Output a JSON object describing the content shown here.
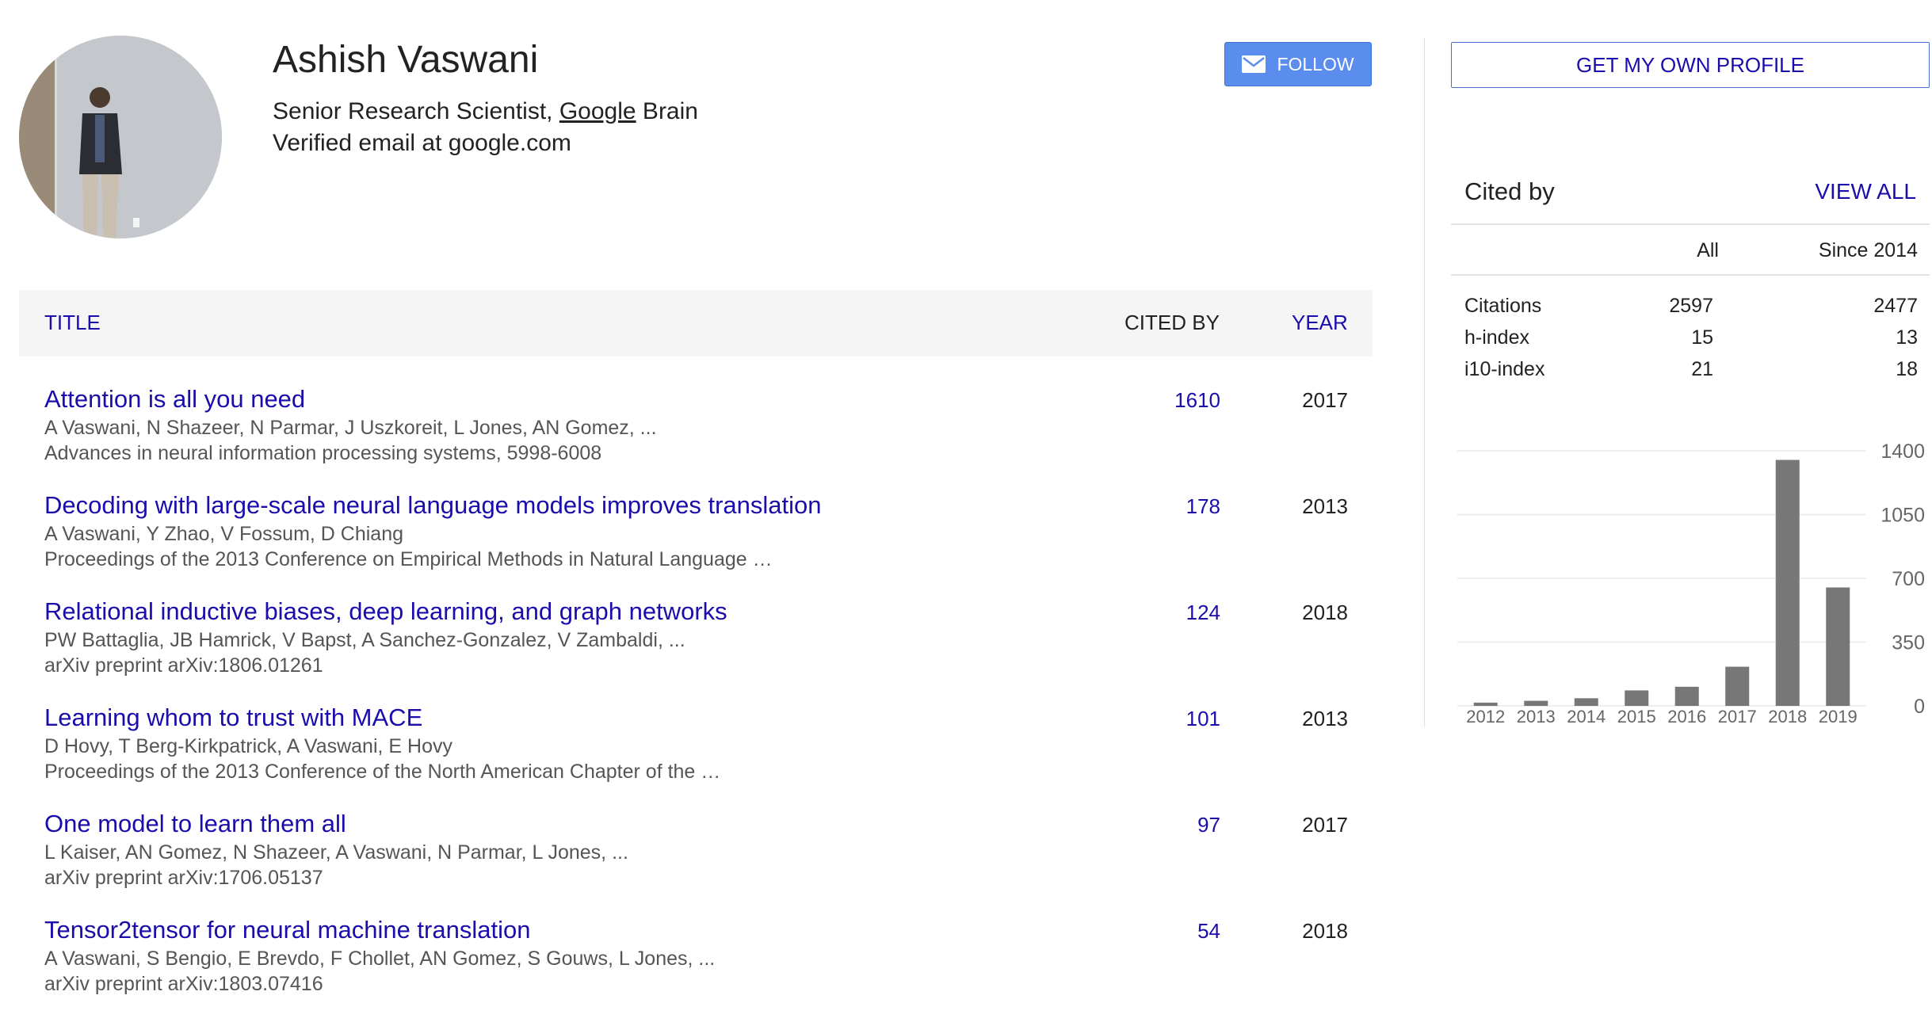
{
  "profile": {
    "name": "Ashish Vaswani",
    "affiliation_prefix": "Senior Research Scientist, ",
    "affiliation_org": "Google",
    "affiliation_suffix": " Brain",
    "email": "Verified email at google.com",
    "follow_label": "FOLLOW"
  },
  "table": {
    "headers": {
      "title": "TITLE",
      "cited_by": "CITED BY",
      "year": "YEAR"
    },
    "rows": [
      {
        "title": "Attention is all you need",
        "authors": "A Vaswani, N Shazeer, N Parmar, J Uszkoreit, L Jones, AN Gomez, ...",
        "venue": "Advances in neural information processing systems, 5998-6008",
        "cited": "1610",
        "year": "2017"
      },
      {
        "title": "Decoding with large-scale neural language models improves translation",
        "authors": "A Vaswani, Y Zhao, V Fossum, D Chiang",
        "venue": "Proceedings of the 2013 Conference on Empirical Methods in Natural Language …",
        "cited": "178",
        "year": "2013"
      },
      {
        "title": "Relational inductive biases, deep learning, and graph networks",
        "authors": "PW Battaglia, JB Hamrick, V Bapst, A Sanchez-Gonzalez, V Zambaldi, ...",
        "venue": "arXiv preprint arXiv:1806.01261",
        "cited": "124",
        "year": "2018"
      },
      {
        "title": "Learning whom to trust with MACE",
        "authors": "D Hovy, T Berg-Kirkpatrick, A Vaswani, E Hovy",
        "venue": "Proceedings of the 2013 Conference of the North American Chapter of the …",
        "cited": "101",
        "year": "2013"
      },
      {
        "title": "One model to learn them all",
        "authors": "L Kaiser, AN Gomez, N Shazeer, A Vaswani, N Parmar, L Jones, ...",
        "venue": "arXiv preprint arXiv:1706.05137",
        "cited": "97",
        "year": "2017"
      },
      {
        "title": "Tensor2tensor for neural machine translation",
        "authors": "A Vaswani, S Bengio, E Brevdo, F Chollet, AN Gomez, S Gouws, L Jones, ...",
        "venue": "arXiv preprint arXiv:1803.07416",
        "cited": "54",
        "year": "2018"
      }
    ]
  },
  "sidebar": {
    "own_profile_label": "GET MY OWN PROFILE",
    "cited_by_title": "Cited by",
    "view_all_label": "VIEW ALL",
    "col_all": "All",
    "col_since": "Since 2014",
    "stats": [
      {
        "label": "Citations",
        "all": "2597",
        "since": "2477"
      },
      {
        "label": "h-index",
        "all": "15",
        "since": "13"
      },
      {
        "label": "i10-index",
        "all": "21",
        "since": "18"
      }
    ]
  },
  "colors": {
    "link": "#1a0dab",
    "button": "#5b8def",
    "bar": "#777777",
    "header_bg": "#f5f5f5"
  },
  "chart_data": {
    "type": "bar",
    "categories": [
      "2012",
      "2013",
      "2014",
      "2015",
      "2016",
      "2017",
      "2018",
      "2019"
    ],
    "values": [
      18,
      28,
      42,
      85,
      105,
      215,
      1350,
      650
    ],
    "yticks": [
      "1400",
      "1050",
      "700",
      "350",
      "0"
    ],
    "ylim": [
      0,
      1400
    ],
    "grid": true
  }
}
